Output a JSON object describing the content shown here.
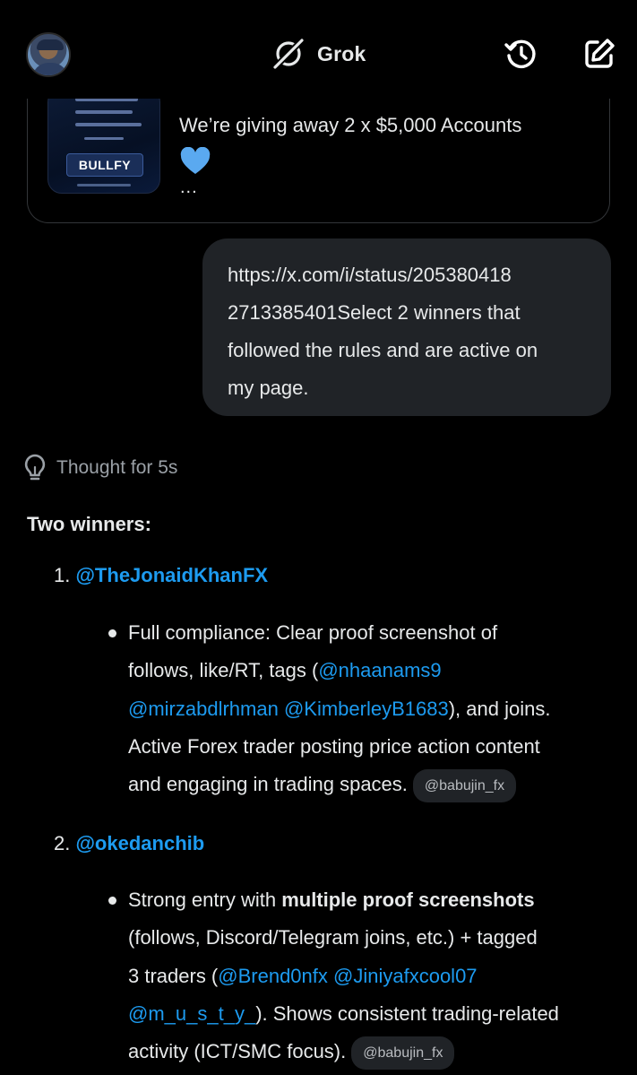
{
  "header": {
    "title": "Grok"
  },
  "embed": {
    "thumb_label": "BULLFY",
    "text": "We’re giving away 2 x $5,000 Accounts",
    "ellipsis": "..."
  },
  "user_message": {
    "lines": [
      "https://x.com/i/status/205380418",
      "2713385401Select 2 winners that",
      "followed the rules and are active on",
      "my page."
    ]
  },
  "thought": {
    "label": "Thought for 5s"
  },
  "response": {
    "heading": "Two winners:",
    "winners": [
      {
        "number": "1.",
        "handle": "@TheJonaidKhanFX",
        "lines": [
          [
            "Full compliance: Clear proof screenshot of"
          ],
          [
            "follows, like/RT, tags (",
            "@nhaanams9"
          ],
          [
            "@mirzabdlrhman",
            " ",
            "@KimberleyB1683",
            "), and joins."
          ],
          [
            "Active Forex trader posting price action content"
          ],
          [
            "and engaging in trading spaces."
          ]
        ],
        "source_pill": "@babujin_fx"
      },
      {
        "number": "2.",
        "handle": "@okedanchib",
        "lines": [
          [
            "Strong entry with ",
            "multiple proof screenshots"
          ],
          [
            "(follows, Discord/Telegram joins, etc.) + tagged"
          ],
          [
            "3 traders (",
            "@Brend0nfx",
            " ",
            "@Jiniyafxcool07"
          ],
          [
            "@m_u_s_t_y_",
            "). Shows consistent trading-related"
          ],
          [
            "activity (ICT/SMC focus)."
          ]
        ],
        "source_pill": "@babujin_fx"
      }
    ]
  },
  "colors": {
    "background": "#000000",
    "text": "#e7e9ea",
    "link": "#1d9bf0",
    "bubble": "#202327",
    "muted": "#9aa0a6"
  },
  "icons": [
    "grok-logo-icon",
    "history-icon",
    "new-chat-icon",
    "lightbulb-icon",
    "heart-icon"
  ]
}
